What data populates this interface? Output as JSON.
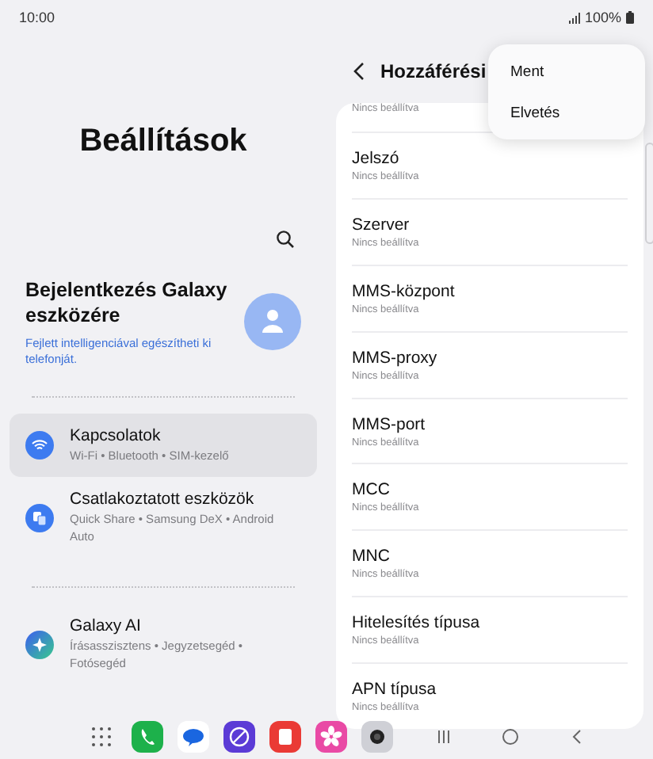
{
  "status_bar": {
    "time": "10:00",
    "battery": "100%"
  },
  "left_pane": {
    "title": "Beállítások",
    "account": {
      "title": "Bejelentkezés Galaxy eszközére",
      "subtitle": "Fejlett intelligenciával egészítheti ki telefonját."
    },
    "groups": [
      [
        {
          "title": "Kapcsolatok",
          "subtitle": "Wi-Fi  •  Bluetooth  •  SIM-kezelő",
          "selected": true,
          "kind": "wifi"
        },
        {
          "title": "Csatlakoztatott eszközök",
          "subtitle": "Quick Share  •  Samsung DeX  •  Android Auto",
          "selected": false,
          "kind": "devices"
        }
      ],
      [
        {
          "title": "Galaxy AI",
          "subtitle": "Írásasszisztens  •  Jegyzetsegéd  •  Fotósegéd",
          "selected": false,
          "kind": "ai"
        }
      ]
    ]
  },
  "right_pane": {
    "title": "Hozzáférési",
    "items": [
      {
        "subtitle": "Nincs beállítva"
      },
      {
        "title": "Jelszó",
        "subtitle": "Nincs beállítva"
      },
      {
        "title": "Szerver",
        "subtitle": "Nincs beállítva"
      },
      {
        "title": "MMS-központ",
        "subtitle": "Nincs beállítva"
      },
      {
        "title": "MMS-proxy",
        "subtitle": "Nincs beállítva"
      },
      {
        "title": "MMS-port",
        "subtitle": "Nincs beállítva"
      },
      {
        "title": "MCC",
        "subtitle": "Nincs beállítva"
      },
      {
        "title": "MNC",
        "subtitle": "Nincs beállítva"
      },
      {
        "title": "Hitelesítés típusa",
        "subtitle": "Nincs beállítva"
      },
      {
        "title": "APN típusa",
        "subtitle": "Nincs beállítva"
      }
    ]
  },
  "menu": [
    "Ment",
    "Elvetés"
  ]
}
